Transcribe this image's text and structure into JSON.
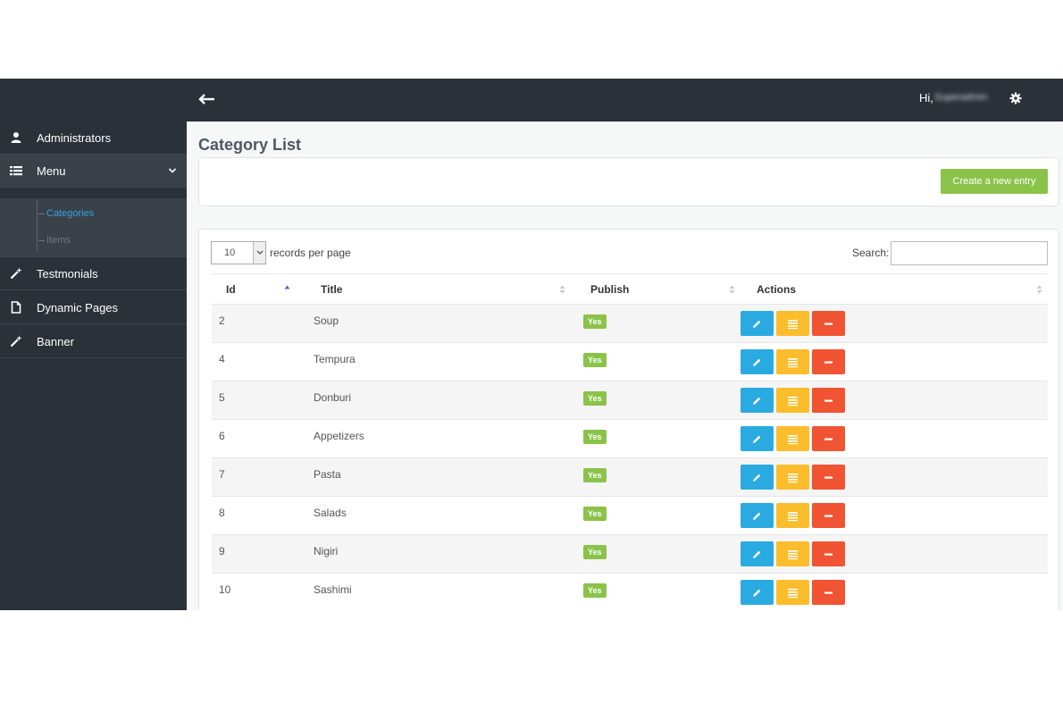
{
  "topbar": {
    "greeting": "Hi,",
    "username": "Superadmin"
  },
  "sidebar": {
    "items": [
      {
        "label": "Administrators",
        "icon": "user-icon"
      },
      {
        "label": "Menu",
        "icon": "list-icon",
        "expanded": true
      },
      {
        "label": "Testmonials",
        "icon": "magic-wand-icon"
      },
      {
        "label": "Dynamic Pages",
        "icon": "file-icon"
      },
      {
        "label": "Banner",
        "icon": "magic-wand-icon"
      }
    ],
    "submenu": [
      {
        "label": "Categories",
        "active": true
      },
      {
        "label": "Items",
        "active": false
      }
    ]
  },
  "main": {
    "title": "Category List",
    "create_button": "Create a new entry",
    "length_value": "10",
    "records_per_page": "records per page",
    "search_label": "Search:",
    "search_value": "",
    "columns": [
      "Id",
      "Title",
      "Publish",
      "Actions"
    ],
    "rows": [
      {
        "id": "2",
        "title": "Soup",
        "publish": "Yes"
      },
      {
        "id": "4",
        "title": "Tempura",
        "publish": "Yes"
      },
      {
        "id": "5",
        "title": "Donburi",
        "publish": "Yes"
      },
      {
        "id": "6",
        "title": "Appetizers",
        "publish": "Yes"
      },
      {
        "id": "7",
        "title": "Pasta",
        "publish": "Yes"
      },
      {
        "id": "8",
        "title": "Salads",
        "publish": "Yes"
      },
      {
        "id": "9",
        "title": "Nigiri",
        "publish": "Yes"
      },
      {
        "id": "10",
        "title": "Sashimi",
        "publish": "Yes"
      }
    ]
  },
  "colors": {
    "sidebar_bg": "#2b3138",
    "submenu_bg": "#3a4149",
    "active_link": "#35a4e0",
    "create_button": "#8bc34a",
    "edit_button": "#29abe2",
    "list_button": "#fbbd2c",
    "delete_button": "#f05433"
  }
}
